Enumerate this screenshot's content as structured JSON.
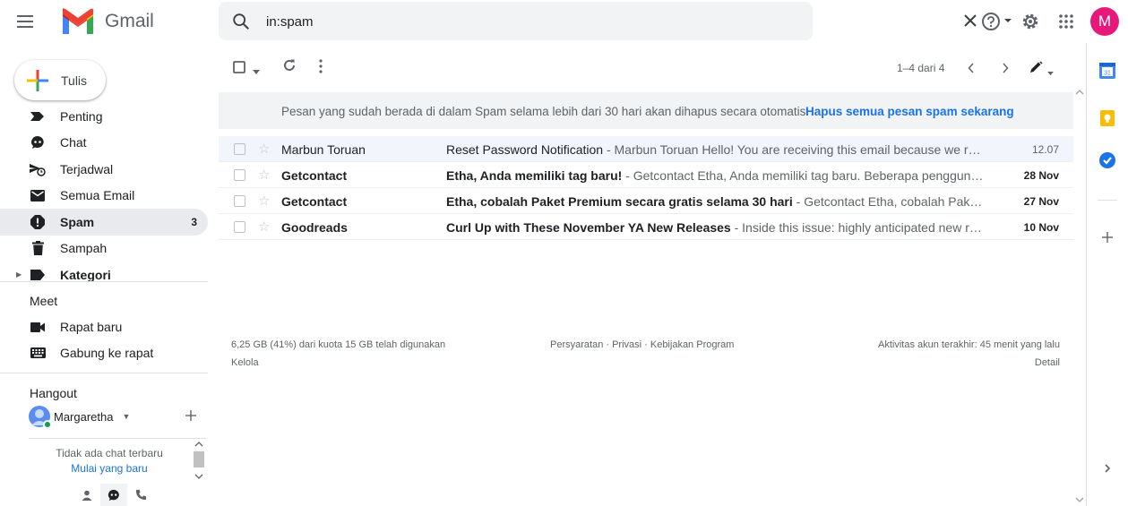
{
  "app": {
    "name": "Gmail"
  },
  "search": {
    "query": "in:spam"
  },
  "profile": {
    "initial": "M",
    "color": "#e8187a"
  },
  "compose": {
    "label": "Tulis"
  },
  "nav": {
    "items": [
      {
        "label": "Penting",
        "icon": "label-important-icon"
      },
      {
        "label": "Chat",
        "icon": "chat-icon"
      },
      {
        "label": "Terjadwal",
        "icon": "scheduled-icon"
      },
      {
        "label": "Semua Email",
        "icon": "all-mail-icon"
      },
      {
        "label": "Spam",
        "icon": "spam-icon",
        "count": "3",
        "active": true
      },
      {
        "label": "Sampah",
        "icon": "trash-icon"
      },
      {
        "label": "Kategori",
        "icon": "category-icon"
      }
    ]
  },
  "meet": {
    "title": "Meet",
    "items": [
      {
        "label": "Rapat baru",
        "icon": "video-icon"
      },
      {
        "label": "Gabung ke rapat",
        "icon": "keyboard-icon"
      }
    ]
  },
  "hangout": {
    "title": "Hangout",
    "user": "Margaretha",
    "empty_text": "Tidak ada chat terbaru",
    "start_link": "Mulai yang baru"
  },
  "toolbar": {
    "pager": "1–4 dari 4"
  },
  "banner": {
    "text": "Pesan yang sudah berada di dalam Spam selama lebih dari 30 hari akan dihapus secara otomatis.",
    "link": "Hapus semua pesan spam sekarang"
  },
  "emails": [
    {
      "sender": "Marbun Toruan",
      "subject": "Reset Password Notification",
      "snippet": " - Marbun Toruan Hello! You are receiving this email because we received a password reset request for your account.",
      "date": "12.07",
      "unread": false
    },
    {
      "sender": "Getcontact",
      "subject": "Etha, Anda memiliki tag baru!",
      "snippet": " - Getcontact Etha, Anda memiliki tag baru. Beberapa pengguna Getcontact telah menyimpan nomor Anda.",
      "date": "28 Nov",
      "unread": true
    },
    {
      "sender": "Getcontact",
      "subject": "Etha, cobalah Paket Premium secara gratis selama 30 hari",
      "snippet": " - Getcontact Etha, cobalah Paket Premium secara gratis.",
      "date": "27 Nov",
      "unread": true
    },
    {
      "sender": "Goodreads",
      "subject": "Curl Up with These November YA New Releases",
      "snippet": " - Inside this issue: highly anticipated new releases, reading challenges and more.",
      "date": "10 Nov",
      "unread": true
    }
  ],
  "footer": {
    "storage": "6,25 GB (41%) dari kuota 15 GB telah digunakan",
    "manage": "Kelola",
    "links": "Persyaratan · Privasi · Kebijakan Program",
    "activity": "Aktivitas akun terakhir: 45 menit yang lalu",
    "details": "Detail"
  }
}
